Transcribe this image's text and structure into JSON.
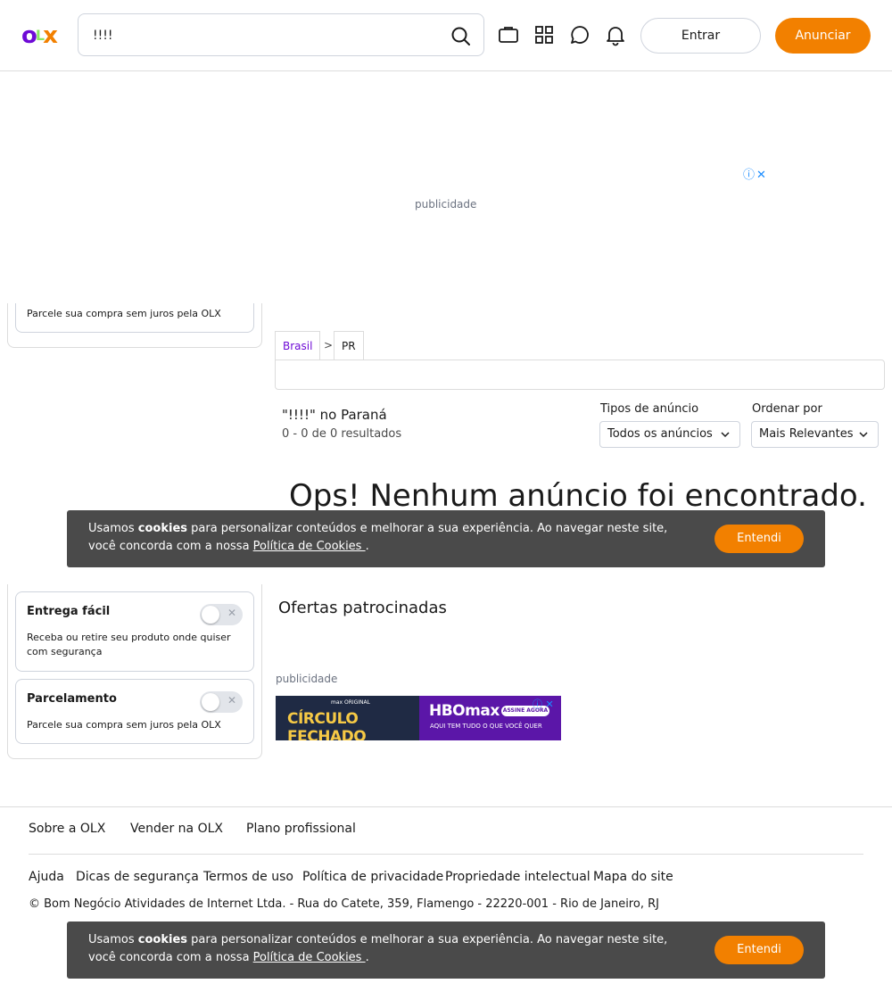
{
  "header": {
    "logo": {
      "o": "o",
      "l": "L",
      "x": "x"
    },
    "search": {
      "value": "!!!!",
      "placeholder": ""
    },
    "login_label": "Entrar",
    "post_ad_label": "Anunciar"
  },
  "icons": {
    "search": "search-icon",
    "plan": "briefcase-icon",
    "categories": "grid-icon",
    "chat": "chat-icon",
    "notifications": "bell-icon"
  },
  "ads": {
    "label": "publicidade",
    "info_glyph": "ⓘ",
    "close_glyph": "✕"
  },
  "breadcrumb": {
    "items": [
      {
        "label": "Brasil"
      },
      {
        "label": "PR"
      }
    ],
    "separator": ">"
  },
  "results": {
    "title": "\"!!!!\" no Paraná",
    "count": "0 - 0 de 0 resultados",
    "empty_title": "Ops! Nenhum anúncio foi encontrado."
  },
  "filters": {
    "ad_type": {
      "label": "Tipos de anúncio",
      "value": "Todos os anúncios"
    },
    "sort": {
      "label": "Ordenar por",
      "value": "Mais Relevantes"
    },
    "partial_card_desc": "Parcele sua compra sem juros pela OLX",
    "cards": [
      {
        "title": "Entrega fácil",
        "desc": "Receba ou retire seu produto onde quiser com segurança",
        "enabled": false
      },
      {
        "title": "Parcelamento",
        "desc": "Parcele sua compra sem juros pela OLX",
        "enabled": false
      }
    ]
  },
  "cookie": {
    "text_before": "Usamos ",
    "bold": "cookies",
    "text_after": " para personalizar conteúdos e melhorar a sua experiência. Ao navegar neste site, você concorda com a nossa ",
    "link": "Política de Cookies ",
    "end": ".",
    "button": "Entendi"
  },
  "sponsored": {
    "title": "Ofertas patrocinadas",
    "banner": {
      "small": "max ORIGINAL",
      "headline": "CÍRCULO FECHADO",
      "brand": "HBOmax",
      "cta": "ASSINE AGORA",
      "tagline": "AQUI TEM TUDO O QUE VOCÊ QUER"
    }
  },
  "footer": {
    "top_links": [
      "Sobre a OLX",
      "Vender na OLX",
      "Plano profissional"
    ],
    "bottom_links": [
      "Ajuda",
      "Dicas de segurança",
      "Termos de uso",
      "Política de privacidade",
      "Propriedade intelectual",
      "Mapa do site"
    ],
    "copyright": "© Bom Negócio Atividades de Internet Ltda. - Rua do Catete, 359, Flamengo - 22220-001 - Rio de Janeiro, RJ"
  },
  "colors": {
    "brand_purple": "#6e0ad6",
    "brand_orange": "#f28000",
    "brand_green": "#8ce563",
    "cookie_bg": "#4a4a4a"
  }
}
